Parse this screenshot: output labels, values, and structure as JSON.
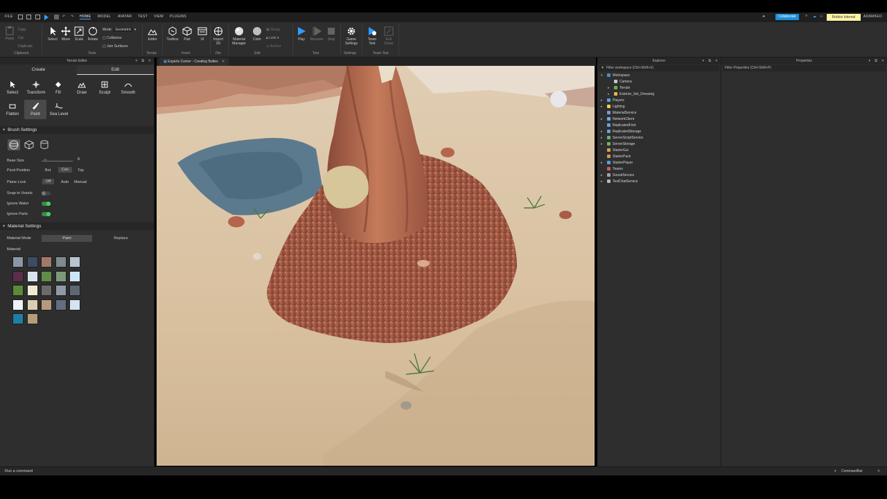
{
  "menubar": {
    "file": "FILE",
    "tabs": [
      "HOME",
      "MODEL",
      "AVATAR",
      "TEST",
      "VIEW",
      "PLUGINS"
    ],
    "collaborate": "Collaborate",
    "badge": "Roblox Internal",
    "user": "ADAMKEO"
  },
  "ribbon": {
    "clipboard": {
      "paste": "Paste",
      "copy": "Copy",
      "cut": "Cut",
      "duplicate": "Duplicate",
      "group": "Clipboard"
    },
    "tools": {
      "select": "Select",
      "move": "Move",
      "scale": "Scale",
      "rotate": "Rotate",
      "mode_label": "Mode:",
      "mode_value": "Geometric",
      "collisions": "Collisions",
      "join": "Join Surfaces",
      "group": "Tools"
    },
    "terrain": {
      "editor": "Editor",
      "group": "Terrain"
    },
    "insert": {
      "toolbox": "Toolbox",
      "part": "Part",
      "ui": "UI",
      "group": "Insert"
    },
    "file": {
      "import": "Import 3D",
      "group": "File"
    },
    "edit": {
      "material": "Material Manager",
      "color": "Color",
      "group_btn": "Group",
      "lock": "Lock",
      "anchor": "Anchor",
      "group": "Edit"
    },
    "test": {
      "play": "Play",
      "resume": "Resume",
      "stop": "Stop",
      "group": "Test"
    },
    "settings": {
      "game": "Game Settings",
      "group": "Settings"
    },
    "teamtest": {
      "team": "Team Test",
      "exit": "Exit Game",
      "group": "Team Test"
    }
  },
  "terrain_editor": {
    "title": "Terrain Editor",
    "tabs": {
      "create": "Create",
      "edit": "Edit"
    },
    "tools": [
      "Select",
      "Transform",
      "Fill",
      "Draw",
      "Sculpt",
      "Smooth",
      "Flatten",
      "Paint",
      "Sea Level"
    ],
    "brush": {
      "heading": "Brush Settings",
      "base_size_label": "Base Size",
      "base_size_value": "6",
      "base_size_fraction": 0.1,
      "pivot_label": "Pivot Position",
      "pivot_options": [
        "Bot",
        "Cen",
        "Top"
      ],
      "plane_label": "Plane Lock",
      "plane_options": [
        "Off",
        "Auto",
        "Manual"
      ],
      "snap_label": "Snap to Voxels",
      "water_label": "Ignore Water",
      "parts_label": "Ignore Parts"
    },
    "material": {
      "heading": "Material Settings",
      "mode_label": "Material Mode",
      "mode_options": [
        "Paint",
        "Replace"
      ],
      "material_label": "Material",
      "swatches": [
        "#8a97a6",
        "#3c4c63",
        "#a07a66",
        "#7f8b8c",
        "#b8c3d0",
        "#5b2e4a",
        "#d8e3ef",
        "#5f8d48",
        "#7c9a79",
        "#cde6f7",
        "#5d8a38",
        "#efe9d2",
        "#6b6b6b",
        "#8e9aa6",
        "#5e6875",
        "#eef2f6",
        "#d9ceb0",
        "#b69a80",
        "#646d80",
        "#d6e3f0",
        "#1f7fa3",
        "#b39d7b"
      ]
    }
  },
  "viewport": {
    "tab": "Experts Corner - Creating Buttes"
  },
  "explorer": {
    "title": "Explorer",
    "filter": "Filter workspace (Ctrl+Shift+X)",
    "items": [
      {
        "label": "Workspace",
        "color": "#4a8fd1",
        "level": 0,
        "arrow": "▾"
      },
      {
        "label": "Camera",
        "color": "#bfc7d0",
        "level": 1,
        "arrow": ""
      },
      {
        "label": "Terrain",
        "color": "#6ab04c",
        "level": 1,
        "arrow": "▸"
      },
      {
        "label": "Exterior_Set_Dressing",
        "color": "#e0b84a",
        "level": 1,
        "arrow": "▸"
      },
      {
        "label": "Players",
        "color": "#5aa0e0",
        "level": 0,
        "arrow": "▸"
      },
      {
        "label": "Lighting",
        "color": "#f1d24a",
        "level": 0,
        "arrow": "▸"
      },
      {
        "label": "MaterialService",
        "color": "#8a8fd8",
        "level": 0,
        "arrow": ""
      },
      {
        "label": "NetworkClient",
        "color": "#6bb0e0",
        "level": 0,
        "arrow": "▸"
      },
      {
        "label": "ReplicatedFirst",
        "color": "#6a9fe0",
        "level": 0,
        "arrow": ""
      },
      {
        "label": "ReplicatedStorage",
        "color": "#6a9fe0",
        "level": 0,
        "arrow": "▸"
      },
      {
        "label": "ServerScriptService",
        "color": "#6bb36a",
        "level": 0,
        "arrow": "▸"
      },
      {
        "label": "ServerStorage",
        "color": "#6bb36a",
        "level": 0,
        "arrow": "▸"
      },
      {
        "label": "StarterGui",
        "color": "#e0a04a",
        "level": 0,
        "arrow": ""
      },
      {
        "label": "StarterPack",
        "color": "#c9a050",
        "level": 0,
        "arrow": ""
      },
      {
        "label": "StarterPlayer",
        "color": "#5aa0e0",
        "level": 0,
        "arrow": "▸"
      },
      {
        "label": "Teams",
        "color": "#d65a5a",
        "level": 0,
        "arrow": ""
      },
      {
        "label": "SoundService",
        "color": "#9aa6b2",
        "level": 0,
        "arrow": "▸"
      },
      {
        "label": "TextChatService",
        "color": "#b0b8c2",
        "level": 0,
        "arrow": "▸"
      }
    ]
  },
  "properties": {
    "title": "Properties",
    "filter": "Filter Properties (Ctrl+Shift+P)"
  },
  "commandbar": {
    "placeholder": "Run a command",
    "label": "CommandBar"
  }
}
